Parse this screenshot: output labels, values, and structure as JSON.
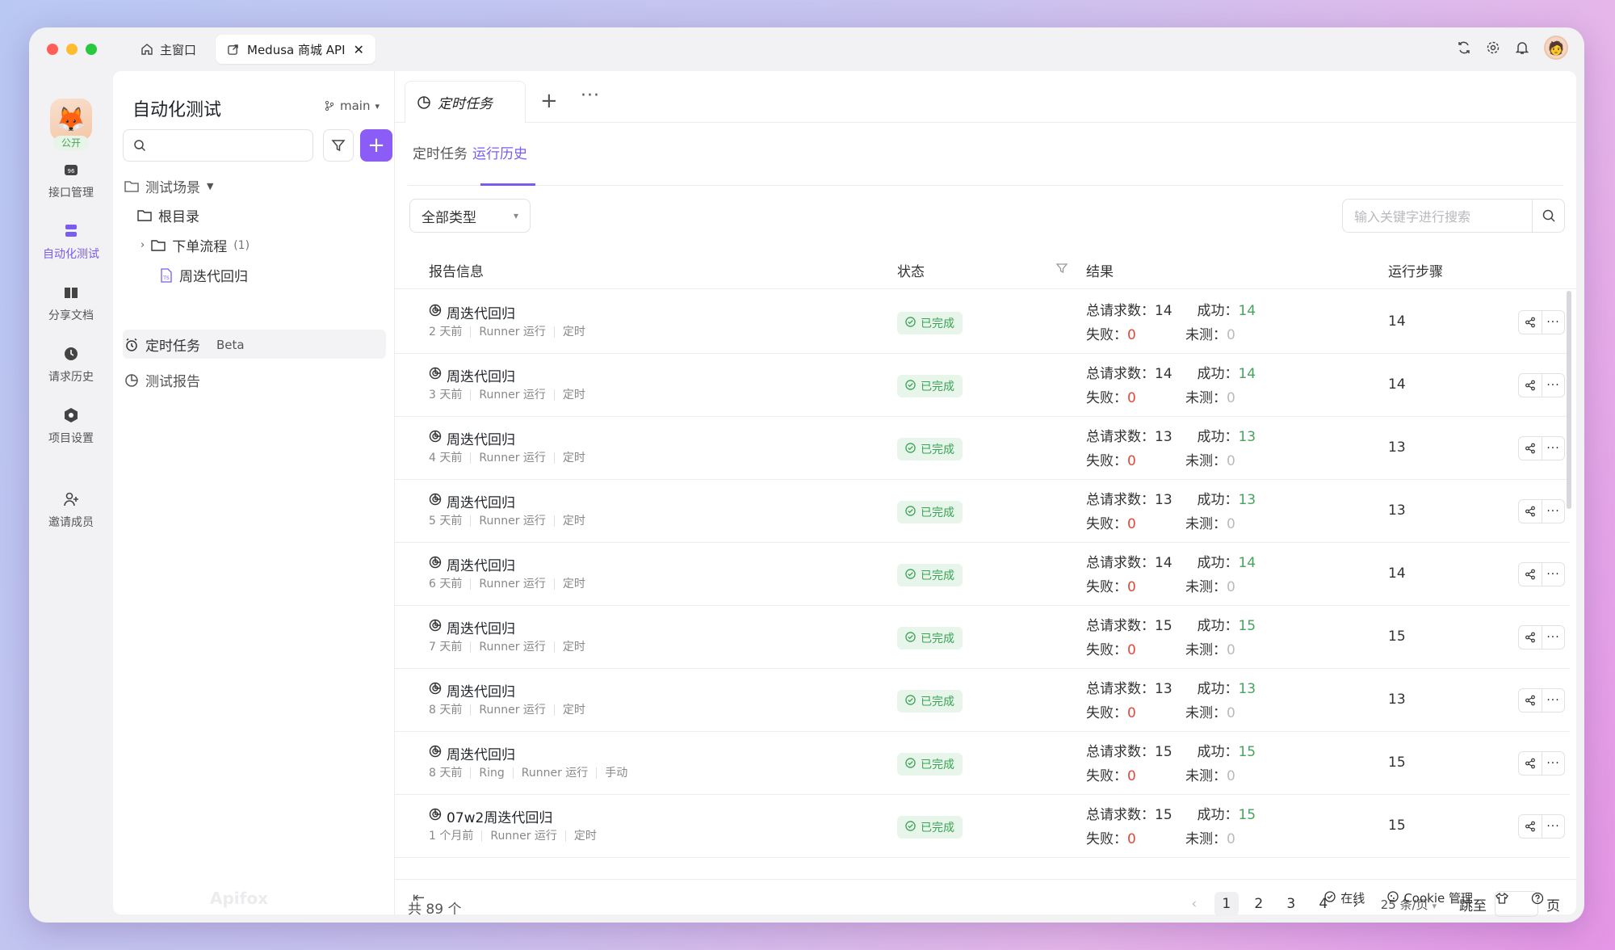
{
  "titlebar": {
    "home_tab": "主窗口",
    "doc_tab": "Medusa 商城 API"
  },
  "rail": {
    "badge": "公开",
    "items": [
      {
        "label": "接口管理"
      },
      {
        "label": "自动化测试"
      },
      {
        "label": "分享文档"
      },
      {
        "label": "请求历史"
      },
      {
        "label": "项目设置"
      },
      {
        "label": "邀请成员"
      }
    ]
  },
  "tree": {
    "title": "自动化测试",
    "branch": "main",
    "scenes": "测试场景",
    "root": "根目录",
    "folder": "下单流程",
    "folder_count": "(1)",
    "file": "周迭代回归",
    "scheduled": "定时任务",
    "beta": "Beta",
    "reports": "测试报告",
    "watermark": "Apifox"
  },
  "main": {
    "doc_tab": "定时任务",
    "subtabs": [
      "定时任务",
      "运行历史"
    ],
    "type_select": "全部类型",
    "search_placeholder": "输入关键字进行搜索",
    "columns": {
      "info": "报告信息",
      "status": "状态",
      "result": "结果",
      "steps": "运行步骤"
    },
    "labels": {
      "total": "总请求数：",
      "success": "成功：",
      "fail": "失败：",
      "untested": "未测："
    },
    "rows": [
      {
        "title": "周迭代回归",
        "meta": [
          "2 天前",
          "Runner 运行",
          "定时"
        ],
        "status": "已完成",
        "total": "14",
        "success": "14",
        "fail": "0",
        "untested": "0",
        "steps": "14"
      },
      {
        "title": "周迭代回归",
        "meta": [
          "3 天前",
          "Runner 运行",
          "定时"
        ],
        "status": "已完成",
        "total": "14",
        "success": "14",
        "fail": "0",
        "untested": "0",
        "steps": "14"
      },
      {
        "title": "周迭代回归",
        "meta": [
          "4 天前",
          "Runner 运行",
          "定时"
        ],
        "status": "已完成",
        "total": "13",
        "success": "13",
        "fail": "0",
        "untested": "0",
        "steps": "13"
      },
      {
        "title": "周迭代回归",
        "meta": [
          "5 天前",
          "Runner 运行",
          "定时"
        ],
        "status": "已完成",
        "total": "13",
        "success": "13",
        "fail": "0",
        "untested": "0",
        "steps": "13"
      },
      {
        "title": "周迭代回归",
        "meta": [
          "6 天前",
          "Runner 运行",
          "定时"
        ],
        "status": "已完成",
        "total": "14",
        "success": "14",
        "fail": "0",
        "untested": "0",
        "steps": "14"
      },
      {
        "title": "周迭代回归",
        "meta": [
          "7 天前",
          "Runner 运行",
          "定时"
        ],
        "status": "已完成",
        "total": "15",
        "success": "15",
        "fail": "0",
        "untested": "0",
        "steps": "15"
      },
      {
        "title": "周迭代回归",
        "meta": [
          "8 天前",
          "Runner 运行",
          "定时"
        ],
        "status": "已完成",
        "total": "13",
        "success": "13",
        "fail": "0",
        "untested": "0",
        "steps": "13"
      },
      {
        "title": "周迭代回归",
        "meta": [
          "8 天前",
          "Ring",
          "Runner 运行",
          "手动"
        ],
        "status": "已完成",
        "total": "15",
        "success": "15",
        "fail": "0",
        "untested": "0",
        "steps": "15"
      },
      {
        "title": "07w2周迭代回归",
        "meta": [
          "1 个月前",
          "Runner 运行",
          "定时"
        ],
        "status": "已完成",
        "total": "15",
        "success": "15",
        "fail": "0",
        "untested": "0",
        "steps": "15"
      }
    ],
    "total_count": "共 89 个",
    "pagination": {
      "pages": [
        "1",
        "2",
        "3",
        "4"
      ],
      "page_size": "25 条/页",
      "jump_label": "跳至",
      "page_unit": "页"
    }
  },
  "statusbar": {
    "online": "在线",
    "cookie": "Cookie 管理"
  },
  "colors": {
    "accent": "#7b5cf0",
    "success": "#47a35c",
    "fail": "#e2483a"
  }
}
